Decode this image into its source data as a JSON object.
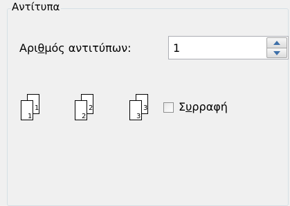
{
  "group": {
    "title": "Αντίτυπα"
  },
  "copies": {
    "label_prefix": "Αρι",
    "label_access": "θ",
    "label_suffix": "μός αντιτύπων:",
    "value": "1"
  },
  "collate_icons": [
    {
      "back": "1",
      "front": "1"
    },
    {
      "back": "2",
      "front": "2"
    },
    {
      "back": "3",
      "front": "3"
    }
  ],
  "collate": {
    "label_prefix": "Σ",
    "label_access": "υ",
    "label_suffix": "ρραφή",
    "checked": false
  }
}
